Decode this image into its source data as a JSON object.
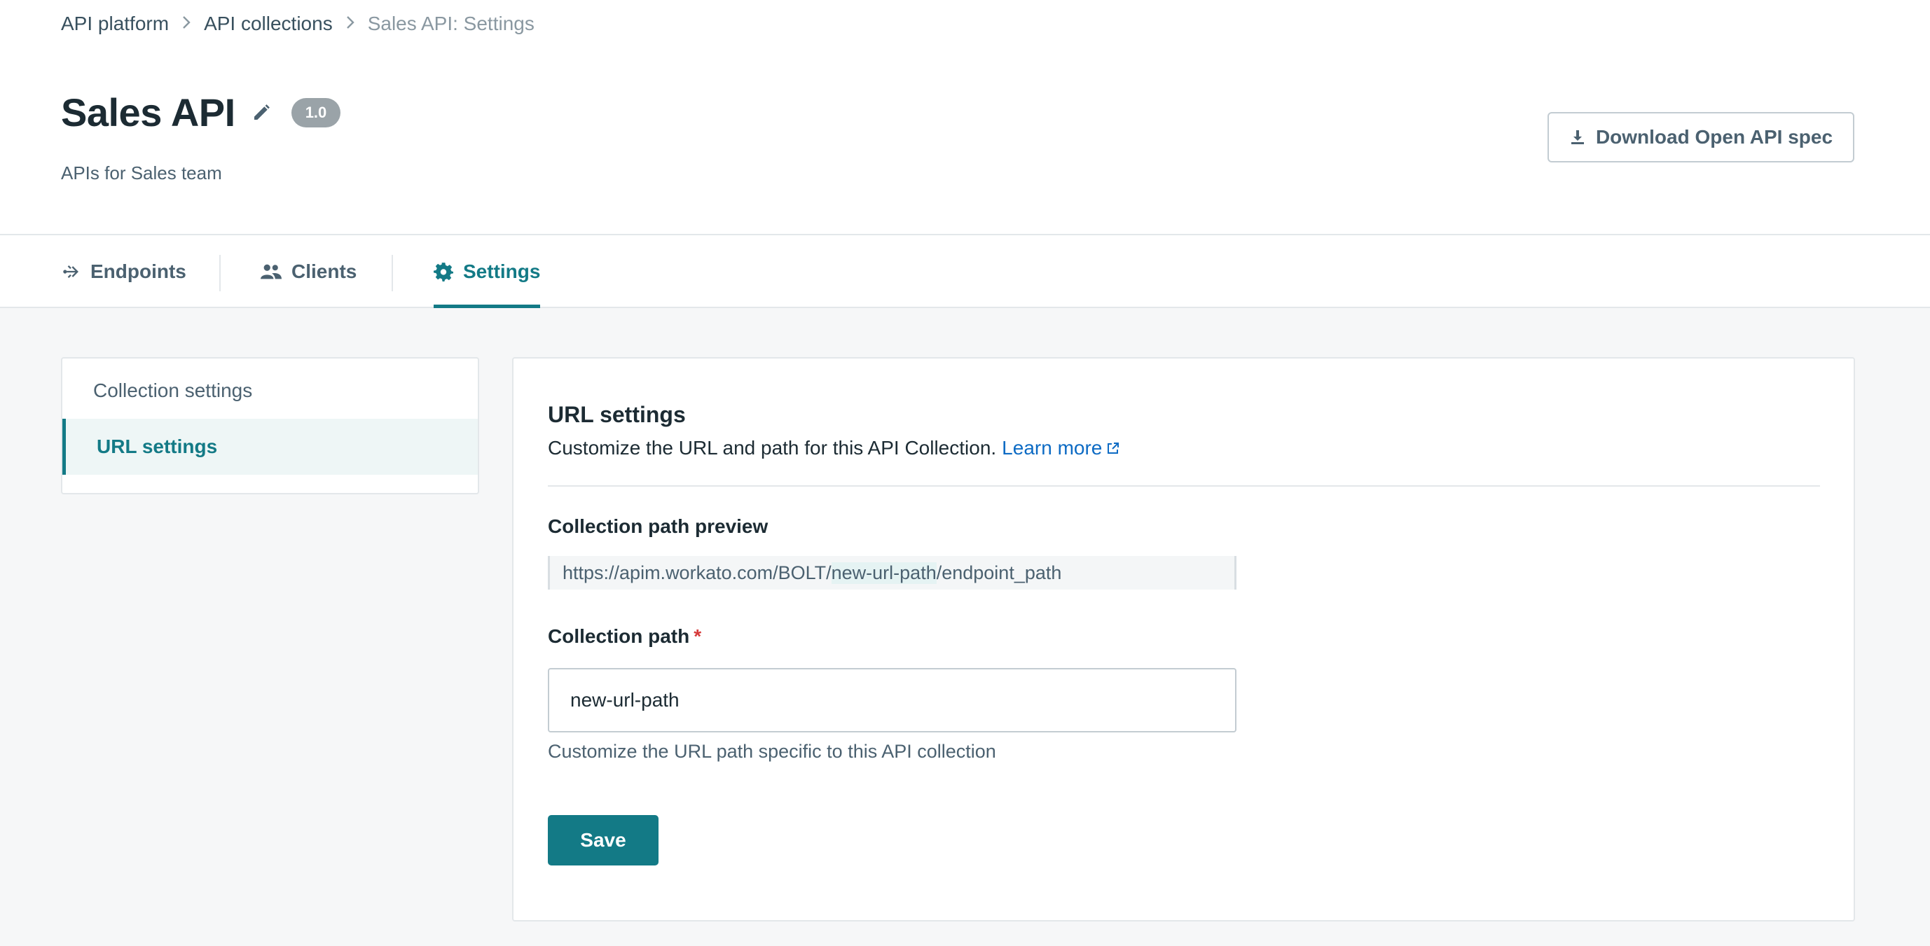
{
  "breadcrumb": {
    "items": [
      "API platform",
      "API collections"
    ],
    "current": "Sales API: Settings"
  },
  "header": {
    "title": "Sales API",
    "version": "1.0",
    "subtitle": "APIs for Sales team",
    "download_label": "Download Open API spec"
  },
  "tabs": [
    {
      "label": "Endpoints",
      "icon": "endpoints-icon",
      "active": false
    },
    {
      "label": "Clients",
      "icon": "users-icon",
      "active": false
    },
    {
      "label": "Settings",
      "icon": "gear-icon",
      "active": true
    }
  ],
  "sidebar": {
    "items": [
      {
        "label": "Collection settings",
        "active": false
      },
      {
        "label": "URL settings",
        "active": true
      }
    ]
  },
  "main": {
    "title": "URL settings",
    "description": "Customize the URL and path for this API Collection.",
    "learn_more": "Learn more",
    "preview_label": "Collection path preview",
    "preview": {
      "prefix": "https://apim.workato.com/BOLT/",
      "path": "new-url-path",
      "suffix": "/endpoint_path"
    },
    "path_label": "Collection path",
    "required_mark": "*",
    "path_value": "new-url-path",
    "path_hint": "Customize the URL path specific to this API collection",
    "save_label": "Save"
  },
  "colors": {
    "accent": "#137a86",
    "link": "#0d6bc4",
    "required": "#d63a3a",
    "badge": "#9aa3a8"
  }
}
